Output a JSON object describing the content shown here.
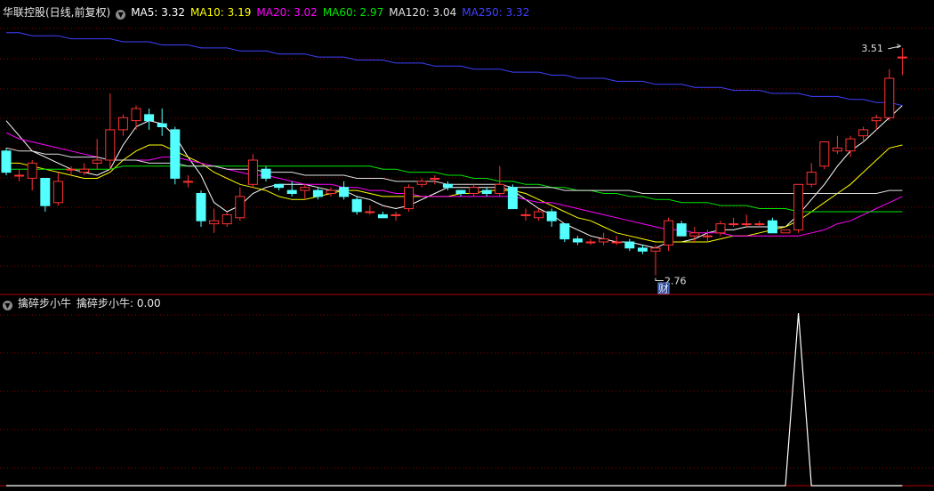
{
  "top_legend": {
    "stock_name": "华联控股(日线,前复权)",
    "stock_color": "#E8E8E8",
    "ma": [
      {
        "label": "MA5: 3.32",
        "color": "#FFFFFF"
      },
      {
        "label": "MA10: 3.19",
        "color": "#FFFF00"
      },
      {
        "label": "MA20: 3.02",
        "color": "#FF00FF"
      },
      {
        "label": "MA60: 2.97",
        "color": "#00E600"
      },
      {
        "label": "MA120: 3.04",
        "color": "#E0E0E0"
      },
      {
        "label": "MA250: 3.32",
        "color": "#4040FF"
      }
    ]
  },
  "bottom_legend": {
    "indicator_name": "擒碎步小牛",
    "value_label": "擒碎步小牛: 0.00",
    "color": "#E8E8E8"
  },
  "annotations": {
    "high_label": "3.51",
    "low_label": "2.76",
    "marker_text": "财"
  },
  "colors": {
    "up": "#FF3232",
    "down": "#54FFFF",
    "grid": "#8B0000",
    "frame": "#B00000",
    "indicator_line": "#FFFFFF"
  },
  "chart_data": [
    {
      "type": "candlestick",
      "title": "华联控股(日线,前复权)",
      "ylim": [
        2.7,
        3.58
      ],
      "candles": [
        [
          3.17,
          3.18,
          3.09,
          3.1
        ],
        [
          3.09,
          3.11,
          3.07,
          3.09
        ],
        [
          3.08,
          3.14,
          3.04,
          3.13
        ],
        [
          3.08,
          3.08,
          2.97,
          2.99
        ],
        [
          3.0,
          3.1,
          2.99,
          3.07
        ],
        [
          3.11,
          3.12,
          3.09,
          3.11
        ],
        [
          3.1,
          3.13,
          3.09,
          3.11
        ],
        [
          3.13,
          3.21,
          3.11,
          3.14
        ],
        [
          3.14,
          3.36,
          3.11,
          3.24
        ],
        [
          3.24,
          3.29,
          3.22,
          3.28
        ],
        [
          3.27,
          3.32,
          3.24,
          3.31
        ],
        [
          3.29,
          3.31,
          3.24,
          3.27
        ],
        [
          3.26,
          3.31,
          3.22,
          3.25
        ],
        [
          3.24,
          3.25,
          3.06,
          3.08
        ],
        [
          3.07,
          3.09,
          3.05,
          3.07
        ],
        [
          3.03,
          3.04,
          2.92,
          2.94
        ],
        [
          2.93,
          2.98,
          2.9,
          2.94
        ],
        [
          2.93,
          2.97,
          2.92,
          2.96
        ],
        [
          2.95,
          3.05,
          2.94,
          3.02
        ],
        [
          3.06,
          3.16,
          3.05,
          3.14
        ],
        [
          3.11,
          3.12,
          3.07,
          3.08
        ],
        [
          3.06,
          3.06,
          3.04,
          3.05
        ],
        [
          3.04,
          3.07,
          3.02,
          3.03
        ],
        [
          3.04,
          3.06,
          3.01,
          3.05
        ],
        [
          3.04,
          3.05,
          3.01,
          3.02
        ],
        [
          3.03,
          3.05,
          3.02,
          3.04
        ],
        [
          3.05,
          3.07,
          3.01,
          3.02
        ],
        [
          3.01,
          3.02,
          2.96,
          2.97
        ],
        [
          2.97,
          2.99,
          2.96,
          2.97
        ],
        [
          2.96,
          2.97,
          2.95,
          2.95
        ],
        [
          2.96,
          2.97,
          2.94,
          2.96
        ],
        [
          2.98,
          3.06,
          2.97,
          3.05
        ],
        [
          3.06,
          3.08,
          3.05,
          3.07
        ],
        [
          3.08,
          3.09,
          3.06,
          3.08
        ],
        [
          3.06,
          3.07,
          3.04,
          3.05
        ],
        [
          3.04,
          3.04,
          3.02,
          3.03
        ],
        [
          3.03,
          3.06,
          3.02,
          3.05
        ],
        [
          3.04,
          3.05,
          3.02,
          3.03
        ],
        [
          3.03,
          3.12,
          3.02,
          3.06
        ],
        [
          3.05,
          3.06,
          2.98,
          2.98
        ],
        [
          2.96,
          2.98,
          2.94,
          2.96
        ],
        [
          2.95,
          2.98,
          2.94,
          2.97
        ],
        [
          2.97,
          2.98,
          2.92,
          2.94
        ],
        [
          2.93,
          2.93,
          2.87,
          2.88
        ],
        [
          2.88,
          2.89,
          2.86,
          2.87
        ],
        [
          2.87,
          2.88,
          2.86,
          2.87
        ],
        [
          2.87,
          2.9,
          2.86,
          2.88
        ],
        [
          2.87,
          2.89,
          2.86,
          2.87
        ],
        [
          2.87,
          2.88,
          2.84,
          2.85
        ],
        [
          2.85,
          2.86,
          2.83,
          2.84
        ],
        [
          2.84,
          2.86,
          2.76,
          2.85
        ],
        [
          2.86,
          2.95,
          2.84,
          2.94
        ],
        [
          2.93,
          2.94,
          2.89,
          2.89
        ],
        [
          2.89,
          2.92,
          2.87,
          2.9
        ],
        [
          2.89,
          2.91,
          2.87,
          2.89
        ],
        [
          2.9,
          2.94,
          2.89,
          2.93
        ],
        [
          2.93,
          2.95,
          2.92,
          2.93
        ],
        [
          2.93,
          2.96,
          2.92,
          2.93
        ],
        [
          2.93,
          2.94,
          2.92,
          2.93
        ],
        [
          2.94,
          2.95,
          2.9,
          2.9
        ],
        [
          2.9,
          2.91,
          2.9,
          2.91
        ],
        [
          2.91,
          3.06,
          2.9,
          3.06
        ],
        [
          3.06,
          3.13,
          3.05,
          3.1
        ],
        [
          3.12,
          3.2,
          3.11,
          3.2
        ],
        [
          3.17,
          3.22,
          3.16,
          3.18
        ],
        [
          3.17,
          3.22,
          3.15,
          3.21
        ],
        [
          3.22,
          3.25,
          3.2,
          3.24
        ],
        [
          3.27,
          3.29,
          3.24,
          3.28
        ],
        [
          3.28,
          3.44,
          3.27,
          3.41
        ],
        [
          3.48,
          3.51,
          3.42,
          3.48
        ]
      ],
      "ma_series": [
        {
          "name": "MA5",
          "color": "#FFFFFF",
          "values": [
            3.27,
            3.22,
            3.17,
            3.15,
            3.13,
            3.11,
            3.1,
            3.09,
            3.11,
            3.19,
            3.25,
            3.27,
            3.26,
            3.22,
            3.15,
            3.09,
            3.0,
            2.97,
            2.99,
            3.03,
            3.05,
            3.06,
            3.06,
            3.06,
            3.05,
            3.04,
            3.04,
            3.02,
            3.01,
            2.99,
            2.98,
            2.99,
            3.01,
            3.03,
            3.05,
            3.05,
            3.05,
            3.05,
            3.05,
            3.04,
            3.01,
            2.98,
            2.96,
            2.93,
            2.91,
            2.89,
            2.88,
            2.87,
            2.87,
            2.86,
            2.85,
            2.87,
            2.87,
            2.88,
            2.9,
            2.91,
            2.91,
            2.92,
            2.92,
            2.92,
            2.92,
            2.96,
            3.01,
            3.06,
            3.12,
            3.17,
            3.2,
            3.24,
            3.28,
            3.32
          ]
        },
        {
          "name": "MA10",
          "color": "#FFFF00",
          "values": [
            3.13,
            3.13,
            3.12,
            3.11,
            3.1,
            3.09,
            3.08,
            3.08,
            3.1,
            3.14,
            3.17,
            3.19,
            3.19,
            3.17,
            3.15,
            3.13,
            3.1,
            3.08,
            3.06,
            3.05,
            3.04,
            3.02,
            3.01,
            3.01,
            3.02,
            3.03,
            3.04,
            3.04,
            3.03,
            3.02,
            3.02,
            3.02,
            3.02,
            3.02,
            3.02,
            3.03,
            3.03,
            3.04,
            3.04,
            3.04,
            3.03,
            3.01,
            2.99,
            2.97,
            2.95,
            2.94,
            2.92,
            2.9,
            2.89,
            2.88,
            2.87,
            2.87,
            2.87,
            2.87,
            2.87,
            2.88,
            2.89,
            2.89,
            2.9,
            2.91,
            2.92,
            2.94,
            2.97,
            3.0,
            3.03,
            3.06,
            3.1,
            3.14,
            3.18,
            3.19
          ]
        },
        {
          "name": "MA20",
          "color": "#FF00FF",
          "values": [
            3.23,
            3.21,
            3.2,
            3.19,
            3.18,
            3.17,
            3.16,
            3.15,
            3.14,
            3.14,
            3.14,
            3.14,
            3.15,
            3.15,
            3.14,
            3.13,
            3.12,
            3.11,
            3.1,
            3.09,
            3.09,
            3.08,
            3.07,
            3.06,
            3.06,
            3.06,
            3.05,
            3.05,
            3.04,
            3.04,
            3.03,
            3.03,
            3.02,
            3.02,
            3.02,
            3.02,
            3.02,
            3.02,
            3.02,
            3.02,
            3.01,
            3.0,
            3.0,
            2.99,
            2.98,
            2.97,
            2.96,
            2.95,
            2.94,
            2.93,
            2.92,
            2.91,
            2.91,
            2.9,
            2.9,
            2.9,
            2.89,
            2.89,
            2.89,
            2.89,
            2.89,
            2.89,
            2.9,
            2.91,
            2.93,
            2.94,
            2.96,
            2.98,
            3.0,
            3.02
          ]
        },
        {
          "name": "MA60",
          "color": "#00E600",
          "values": [
            3.11,
            3.11,
            3.11,
            3.11,
            3.11,
            3.11,
            3.11,
            3.11,
            3.11,
            3.12,
            3.12,
            3.12,
            3.12,
            3.12,
            3.12,
            3.12,
            3.12,
            3.12,
            3.12,
            3.12,
            3.12,
            3.12,
            3.12,
            3.12,
            3.12,
            3.12,
            3.12,
            3.12,
            3.12,
            3.11,
            3.11,
            3.1,
            3.1,
            3.1,
            3.09,
            3.09,
            3.08,
            3.08,
            3.07,
            3.07,
            3.06,
            3.06,
            3.05,
            3.05,
            3.04,
            3.04,
            3.03,
            3.03,
            3.02,
            3.02,
            3.01,
            3.01,
            3.0,
            3.0,
            3.0,
            2.99,
            2.99,
            2.99,
            2.98,
            2.98,
            2.98,
            2.97,
            2.97,
            2.97,
            2.97,
            2.97,
            2.97,
            2.97,
            2.97,
            2.97
          ]
        },
        {
          "name": "MA120",
          "color": "#E0E0E0",
          "values": [
            3.18,
            3.17,
            3.17,
            3.16,
            3.16,
            3.15,
            3.15,
            3.15,
            3.14,
            3.14,
            3.14,
            3.13,
            3.13,
            3.13,
            3.12,
            3.12,
            3.12,
            3.11,
            3.11,
            3.11,
            3.1,
            3.1,
            3.1,
            3.09,
            3.09,
            3.09,
            3.09,
            3.08,
            3.08,
            3.08,
            3.07,
            3.07,
            3.07,
            3.07,
            3.06,
            3.06,
            3.06,
            3.06,
            3.06,
            3.05,
            3.05,
            3.05,
            3.05,
            3.04,
            3.04,
            3.04,
            3.04,
            3.04,
            3.04,
            3.03,
            3.03,
            3.03,
            3.03,
            3.03,
            3.03,
            3.03,
            3.03,
            3.03,
            3.03,
            3.03,
            3.03,
            3.03,
            3.03,
            3.03,
            3.03,
            3.03,
            3.03,
            3.03,
            3.04,
            3.04
          ]
        },
        {
          "name": "MA250",
          "color": "#4040FF",
          "values": [
            3.56,
            3.56,
            3.55,
            3.55,
            3.55,
            3.54,
            3.54,
            3.54,
            3.54,
            3.53,
            3.53,
            3.53,
            3.52,
            3.52,
            3.52,
            3.51,
            3.51,
            3.51,
            3.5,
            3.5,
            3.5,
            3.49,
            3.49,
            3.49,
            3.48,
            3.48,
            3.48,
            3.47,
            3.47,
            3.47,
            3.46,
            3.46,
            3.46,
            3.45,
            3.45,
            3.45,
            3.44,
            3.44,
            3.44,
            3.43,
            3.43,
            3.43,
            3.42,
            3.42,
            3.41,
            3.41,
            3.41,
            3.4,
            3.4,
            3.4,
            3.39,
            3.39,
            3.39,
            3.38,
            3.38,
            3.38,
            3.37,
            3.37,
            3.37,
            3.36,
            3.36,
            3.36,
            3.35,
            3.35,
            3.35,
            3.34,
            3.34,
            3.33,
            3.33,
            3.32
          ]
        }
      ]
    },
    {
      "type": "line",
      "title": "擒碎步小牛",
      "ylim": [
        0,
        1
      ],
      "series": [
        {
          "name": "擒碎步小牛",
          "color": "#FFFFFF",
          "values": [
            0,
            0,
            0,
            0,
            0,
            0,
            0,
            0,
            0,
            0,
            0,
            0,
            0,
            0,
            0,
            0,
            0,
            0,
            0,
            0,
            0,
            0,
            0,
            0,
            0,
            0,
            0,
            0,
            0,
            0,
            0,
            0,
            0,
            0,
            0,
            0,
            0,
            0,
            0,
            0,
            0,
            0,
            0,
            0,
            0,
            0,
            0,
            0,
            0,
            0,
            0,
            0,
            0,
            0,
            0,
            0,
            0,
            0,
            0,
            0,
            0,
            1,
            0,
            0,
            0,
            0,
            0,
            0,
            0,
            0
          ]
        }
      ]
    }
  ]
}
